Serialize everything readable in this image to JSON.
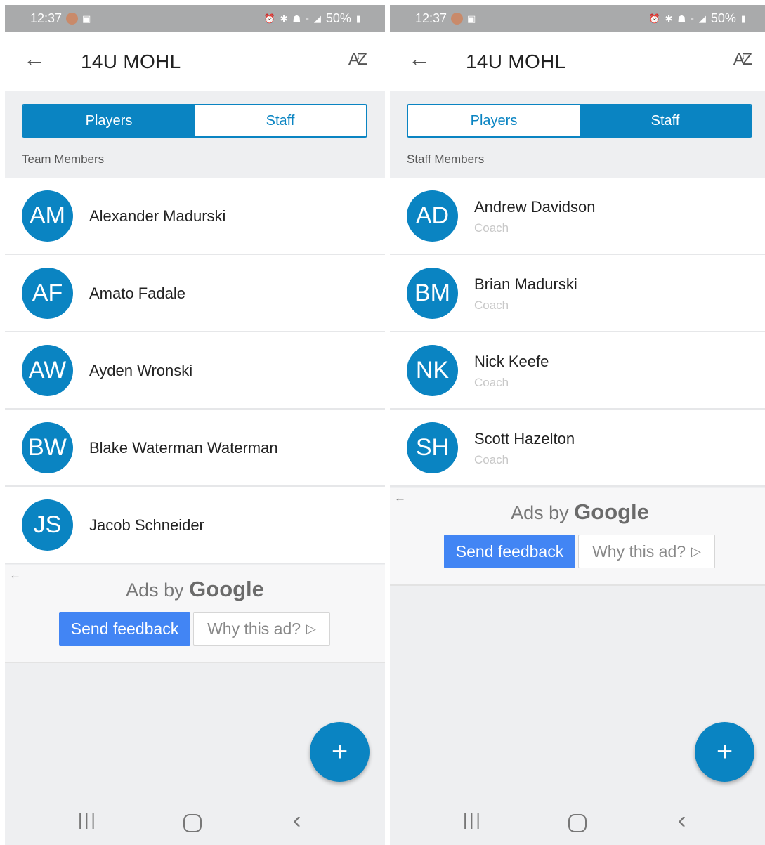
{
  "screens": [
    {
      "status": {
        "time": "12:37",
        "battery": "50%",
        "icons_right": [
          "alarm-icon",
          "bluetooth-icon",
          "wifi-icon",
          "4g-icon",
          "signal-icon",
          "battery-icon"
        ]
      },
      "appbar": {
        "title": "14U MOHL",
        "sort_label": "AZ"
      },
      "tabs": [
        {
          "label": "Players",
          "active": true
        },
        {
          "label": "Staff",
          "active": false
        }
      ],
      "section_label": "Team Members",
      "members": [
        {
          "initials": "AM",
          "name": "Alexander Madurski"
        },
        {
          "initials": "AF",
          "name": "Amato Fadale"
        },
        {
          "initials": "AW",
          "name": "Ayden Wronski"
        },
        {
          "initials": "BW",
          "name": "Blake Waterman Waterman"
        },
        {
          "initials": "JS",
          "name": "Jacob Schneider"
        }
      ],
      "ad": {
        "ads_by": "Ads by",
        "google": "Google",
        "send_feedback": "Send feedback",
        "why_this_ad": "Why this ad?"
      },
      "fab": "+"
    },
    {
      "status": {
        "time": "12:37",
        "battery": "50%",
        "icons_right": [
          "alarm-icon",
          "bluetooth-icon",
          "wifi-icon",
          "4g-icon",
          "signal-icon",
          "battery-icon"
        ]
      },
      "appbar": {
        "title": "14U MOHL",
        "sort_label": "AZ"
      },
      "tabs": [
        {
          "label": "Players",
          "active": false
        },
        {
          "label": "Staff",
          "active": true
        }
      ],
      "section_label": "Staff Members",
      "members": [
        {
          "initials": "AD",
          "name": "Andrew Davidson",
          "role": "Coach"
        },
        {
          "initials": "BM",
          "name": "Brian Madurski",
          "role": "Coach"
        },
        {
          "initials": "NK",
          "name": "Nick Keefe",
          "role": "Coach"
        },
        {
          "initials": "SH",
          "name": "Scott Hazelton",
          "role": "Coach"
        }
      ],
      "ad": {
        "ads_by": "Ads by",
        "google": "Google",
        "send_feedback": "Send feedback",
        "why_this_ad": "Why this ad?"
      },
      "fab": "+"
    }
  ],
  "colors": {
    "accent": "#0a84c2",
    "ad_button": "#4285f4",
    "background": "#eeeff1",
    "statusbar": "#a9aaab"
  }
}
